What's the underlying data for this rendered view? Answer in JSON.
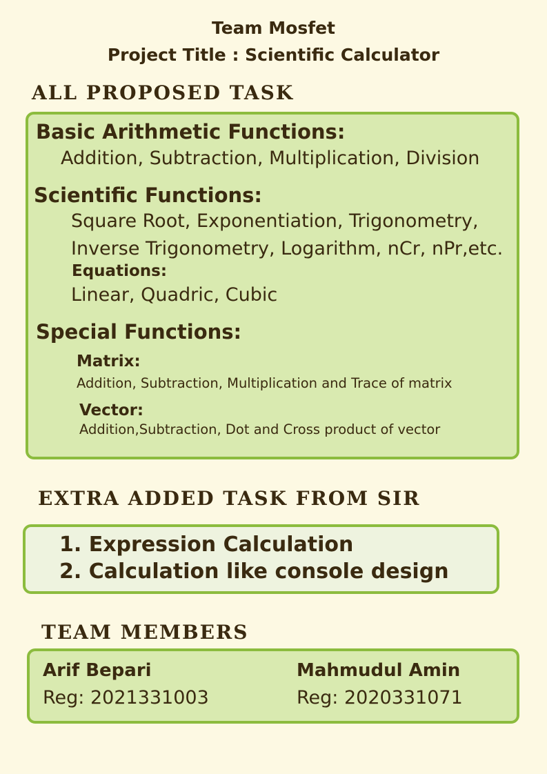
{
  "header": {
    "team_name": "Team Mosfet",
    "project_title": "Project Title : Scientific Calculator"
  },
  "proposed": {
    "heading": "ALL PROPOSED TASK",
    "basic": {
      "title": "Basic Arithmetic Functions:",
      "items": "Addition,  Subtraction, Multiplication,  Division"
    },
    "scientific": {
      "title": "Scientific  Functions:",
      "line1": "Square Root,  Exponentiation,  Trigonometry,",
      "line2": "Inverse Trigonometry, Logarithm, nCr, nPr,etc.",
      "equations_title": "Equations:",
      "equations_items": "Linear, Quadric, Cubic"
    },
    "special": {
      "title": "Special Functions:",
      "matrix_title": "Matrix:",
      "matrix_items": "Addition, Subtraction, Multiplication and Trace of matrix",
      "vector_title": "Vector:",
      "vector_items": "Addition,Subtraction, Dot and Cross product of vector"
    }
  },
  "extra": {
    "heading": "EXTRA ADDED TASK FROM SIR",
    "items": [
      "1. Expression Calculation",
      "2. Calculation like console design"
    ]
  },
  "team": {
    "heading": "TEAM MEMBERS",
    "members": [
      {
        "name": "Arif Bepari",
        "reg": "Reg: 2021331003"
      },
      {
        "name": "Mahmudul Amin",
        "reg": "Reg: 2020331071"
      }
    ]
  },
  "colors": {
    "background": "#fdf9e3",
    "box_fill": "#d9eab0",
    "box_fill_light": "#eef3df",
    "box_border": "#8cbc3e",
    "text": "#3a2a10"
  }
}
